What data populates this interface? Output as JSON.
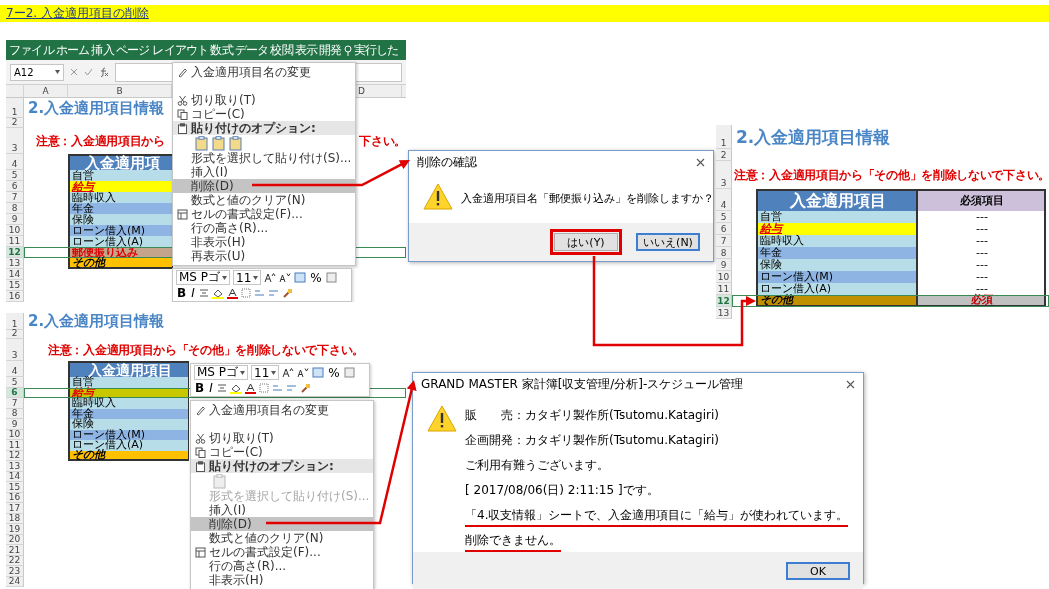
{
  "heading": "7ー2. 入金適用項目の削除",
  "sheet_top_left": {
    "ribbon_tabs": [
      {
        "label": "ファイル",
        "kind": "tab"
      },
      {
        "label": "ホーム",
        "kind": "tab"
      },
      {
        "label": "挿入",
        "kind": "tab"
      },
      {
        "label": "ページ レイアウト",
        "kind": "tab"
      },
      {
        "label": "数式",
        "kind": "tab"
      },
      {
        "label": "データ",
        "kind": "tab"
      },
      {
        "label": "校閲",
        "kind": "tab"
      },
      {
        "label": "表示",
        "kind": "tab"
      },
      {
        "label": "開発",
        "kind": "tab"
      },
      {
        "label": "実行した",
        "kind": "tell_me"
      }
    ],
    "name_box": "A12",
    "column_headers": [
      "A",
      "B",
      "D"
    ],
    "rows": [
      {
        "number": "1",
        "selected": false
      },
      {
        "number": "2",
        "selected": false
      },
      {
        "number": "3",
        "selected": false
      },
      {
        "number": "4",
        "selected": false
      },
      {
        "number": "5",
        "selected": false
      },
      {
        "number": "6",
        "selected": false
      },
      {
        "number": "7",
        "selected": false
      },
      {
        "number": "8",
        "selected": false
      },
      {
        "number": "9",
        "selected": false
      },
      {
        "number": "10",
        "selected": false
      },
      {
        "number": "11",
        "selected": false
      },
      {
        "number": "12",
        "selected": true
      },
      {
        "number": "13",
        "selected": false
      },
      {
        "number": "14",
        "selected": false
      },
      {
        "number": "15",
        "selected": false
      },
      {
        "number": "16",
        "selected": false
      }
    ],
    "title": "2.入金適用項目情報",
    "notice": [
      "注意：入金適用項目から",
      "下さい。"
    ],
    "table": {
      "headers": [
        "入金適用項"
      ],
      "items": [
        {
          "label": "自営",
          "kind": "plain",
          "color": "#b7dee8"
        },
        {
          "label": "給与",
          "kind": "emphasis",
          "color": "#ffff00"
        },
        {
          "label": "臨時収入",
          "kind": "plain",
          "color": "#b7dee8"
        },
        {
          "label": "年金",
          "kind": "plain",
          "color": "#8db4e2"
        },
        {
          "label": "保険",
          "kind": "plain",
          "color": "#b7dee8"
        },
        {
          "label": "ローン借入(M)",
          "kind": "plain",
          "color": "#8db4e2"
        },
        {
          "label": "ローン借入(A)",
          "kind": "plain",
          "color": "#b7dee8"
        },
        {
          "label": "郵便振り込み",
          "kind": "warning",
          "color": "#c4a48a"
        },
        {
          "label": "その他",
          "kind": "total",
          "color": "#ffc000"
        }
      ]
    },
    "context_menu": {
      "items": [
        {
          "label": "入金適用項目名の変更",
          "kind": "rename",
          "selected": false,
          "disabled": false
        },
        {
          "kind": "blank"
        },
        {
          "label": "切り取り(T)",
          "kind": "cut",
          "selected": false,
          "disabled": false
        },
        {
          "label": "コピー(C)",
          "kind": "copy",
          "selected": false,
          "disabled": false
        },
        {
          "label": "貼り付けのオプション:",
          "kind": "paste_header",
          "selected": false,
          "disabled": false
        },
        {
          "kind": "paste_icons",
          "selected": false,
          "disabled": false
        },
        {
          "label": "形式を選択して貼り付け(S)...",
          "kind": "plain",
          "selected": false,
          "disabled": false
        },
        {
          "label": "挿入(I)",
          "kind": "plain",
          "selected": false,
          "disabled": false
        },
        {
          "label": "削除(D)",
          "kind": "plain",
          "selected": true,
          "disabled": false
        },
        {
          "label": "数式と値のクリア(N)",
          "kind": "plain",
          "selected": false,
          "disabled": false
        },
        {
          "label": "セルの書式設定(F)...",
          "kind": "format",
          "selected": false,
          "disabled": false
        },
        {
          "label": "行の高さ(R)...",
          "kind": "plain",
          "selected": false,
          "disabled": false
        },
        {
          "label": "非表示(H)",
          "kind": "plain",
          "selected": false,
          "disabled": false
        },
        {
          "label": "再表示(U)",
          "kind": "plain",
          "selected": false,
          "disabled": false
        }
      ]
    },
    "mini_toolbar": {
      "font": "MS Pゴ",
      "size": "11",
      "percent": "%",
      "bold": "B",
      "italic": "I"
    }
  },
  "dialog_confirm": {
    "title": "削除の確認",
    "message": "入金適用項目名「郵便振り込み」を削除しますか？",
    "buttons": [
      {
        "label": "はい(Y)",
        "focused": false,
        "highlighted": true
      },
      {
        "label": "いいえ(N)",
        "focused": true,
        "highlighted": false
      }
    ]
  },
  "sheet_right": {
    "rows": [
      {
        "number": "1",
        "selected": false
      },
      {
        "number": "2",
        "selected": false
      },
      {
        "number": "3",
        "selected": false
      },
      {
        "number": "4",
        "selected": false
      },
      {
        "number": "5",
        "selected": false
      },
      {
        "number": "6",
        "selected": false
      },
      {
        "number": "7",
        "selected": false
      },
      {
        "number": "8",
        "selected": false
      },
      {
        "number": "9",
        "selected": false
      },
      {
        "number": "10",
        "selected": false
      },
      {
        "number": "11",
        "selected": false
      },
      {
        "number": "12",
        "selected": true
      },
      {
        "number": "13",
        "selected": false
      }
    ],
    "title": "2.入金適用項目情報",
    "notice": [
      "注意：入金適用項目から「その他」を削除しないで下さい。"
    ],
    "table": {
      "headers": [
        "入金適用項目",
        "必須項目"
      ],
      "items": [
        {
          "label": "自営",
          "kind": "plain",
          "color": "#b7dee8",
          "value": "---"
        },
        {
          "label": "給与",
          "kind": "emphasis",
          "color": "#ffff00",
          "value": "---"
        },
        {
          "label": "臨時収入",
          "kind": "plain",
          "color": "#b7dee8",
          "value": "---"
        },
        {
          "label": "年金",
          "kind": "plain",
          "color": "#8db4e2",
          "value": "---"
        },
        {
          "label": "保険",
          "kind": "plain",
          "color": "#b7dee8",
          "value": "---"
        },
        {
          "label": "ローン借入(M)",
          "kind": "plain",
          "color": "#8db4e2",
          "value": "---"
        },
        {
          "label": "ローン借入(A)",
          "kind": "plain",
          "color": "#b7dee8",
          "value": "---"
        },
        {
          "label": "その他",
          "kind": "total",
          "color": "#c09000",
          "value": "必須"
        }
      ]
    }
  },
  "sheet_bottom_left": {
    "rows": [
      {
        "number": "1",
        "selected": false
      },
      {
        "number": "2",
        "selected": false
      },
      {
        "number": "3",
        "selected": false
      },
      {
        "number": "4",
        "selected": false
      },
      {
        "number": "5",
        "selected": false
      },
      {
        "number": "6",
        "selected": true
      },
      {
        "number": "7",
        "selected": false
      },
      {
        "number": "8",
        "selected": false
      },
      {
        "number": "9",
        "selected": false
      },
      {
        "number": "10",
        "selected": false
      },
      {
        "number": "11",
        "selected": false
      },
      {
        "number": "12",
        "selected": false
      },
      {
        "number": "13",
        "selected": false
      },
      {
        "number": "14",
        "selected": false
      },
      {
        "number": "15",
        "selected": false
      },
      {
        "number": "16",
        "selected": false
      },
      {
        "number": "17",
        "selected": false
      },
      {
        "number": "18",
        "selected": false
      },
      {
        "number": "19",
        "selected": false
      },
      {
        "number": "20",
        "selected": false
      },
      {
        "number": "21",
        "selected": false
      },
      {
        "number": "22",
        "selected": false
      },
      {
        "number": "23",
        "selected": false
      },
      {
        "number": "24",
        "selected": false
      }
    ],
    "title": "2.入金適用項目情報",
    "notice": [
      "注意：入金適用項目から「その他」を削除しないで下さい。"
    ],
    "table": {
      "headers": [
        "入金適用項目"
      ],
      "items": [
        {
          "label": "自営",
          "kind": "plain",
          "color": "#b7dee8"
        },
        {
          "label": "給与",
          "kind": "emphasis",
          "color": "#c8c800"
        },
        {
          "label": "臨時収入",
          "kind": "plain",
          "color": "#b7dee8"
        },
        {
          "label": "年金",
          "kind": "plain",
          "color": "#8db4e2"
        },
        {
          "label": "保険",
          "kind": "plain",
          "color": "#b7dee8"
        },
        {
          "label": "ローン借入(M)",
          "kind": "plain",
          "color": "#8db4e2"
        },
        {
          "label": "ローン借入(A)",
          "kind": "plain",
          "color": "#b7dee8"
        },
        {
          "label": "その他",
          "kind": "total",
          "color": "#ffc000"
        }
      ]
    },
    "mini_toolbar": {
      "font": "MS Pゴ",
      "size": "11",
      "percent": "%",
      "bold": "B",
      "italic": "I"
    },
    "context_menu": {
      "items": [
        {
          "label": "入金適用項目名の変更",
          "kind": "rename",
          "selected": false,
          "disabled": false
        },
        {
          "kind": "blank"
        },
        {
          "label": "切り取り(T)",
          "kind": "cut",
          "selected": false,
          "disabled": false
        },
        {
          "label": "コピー(C)",
          "kind": "copy",
          "selected": false,
          "disabled": false
        },
        {
          "label": "貼り付けのオプション:",
          "kind": "paste_header",
          "selected": false,
          "disabled": false
        },
        {
          "kind": "paste_icons",
          "selected": false,
          "disabled": true
        },
        {
          "label": "形式を選択して貼り付け(S)...",
          "kind": "plain",
          "selected": false,
          "disabled": true
        },
        {
          "label": "挿入(I)",
          "kind": "plain",
          "selected": false,
          "disabled": false
        },
        {
          "label": "削除(D)",
          "kind": "plain",
          "selected": true,
          "disabled": false
        },
        {
          "label": "数式と値のクリア(N)",
          "kind": "plain",
          "selected": false,
          "disabled": false
        },
        {
          "label": "セルの書式設定(F)...",
          "kind": "format",
          "selected": false,
          "disabled": false
        },
        {
          "label": "行の高さ(R)...",
          "kind": "plain",
          "selected": false,
          "disabled": false
        },
        {
          "label": "非表示(H)",
          "kind": "plain",
          "selected": false,
          "disabled": false
        }
      ]
    }
  },
  "dialog_error": {
    "title": "GRAND MASTER 家計簿[収支管理/分析]-スケジュール管理",
    "lines": [
      {
        "text": "販　　売：カタギリ製作所(Tsutomu.Katagiri)",
        "underlined": false
      },
      {
        "text": "企画開発：カタギリ製作所(Tsutomu.Katagiri)",
        "underlined": false
      },
      {
        "text": "ご利用有難うございます。",
        "underlined": false
      },
      {
        "text": "[ 2017/08/06(日) 2:11:15 ]です。",
        "underlined": false
      },
      {
        "text": "「4.収支情報」シートで、入金適用項目に「給与」が使われています。",
        "underlined": true
      },
      {
        "text": "削除できません。",
        "underlined": true
      }
    ],
    "buttons": [
      {
        "label": "OK",
        "focused": true,
        "highlighted": false
      }
    ]
  }
}
